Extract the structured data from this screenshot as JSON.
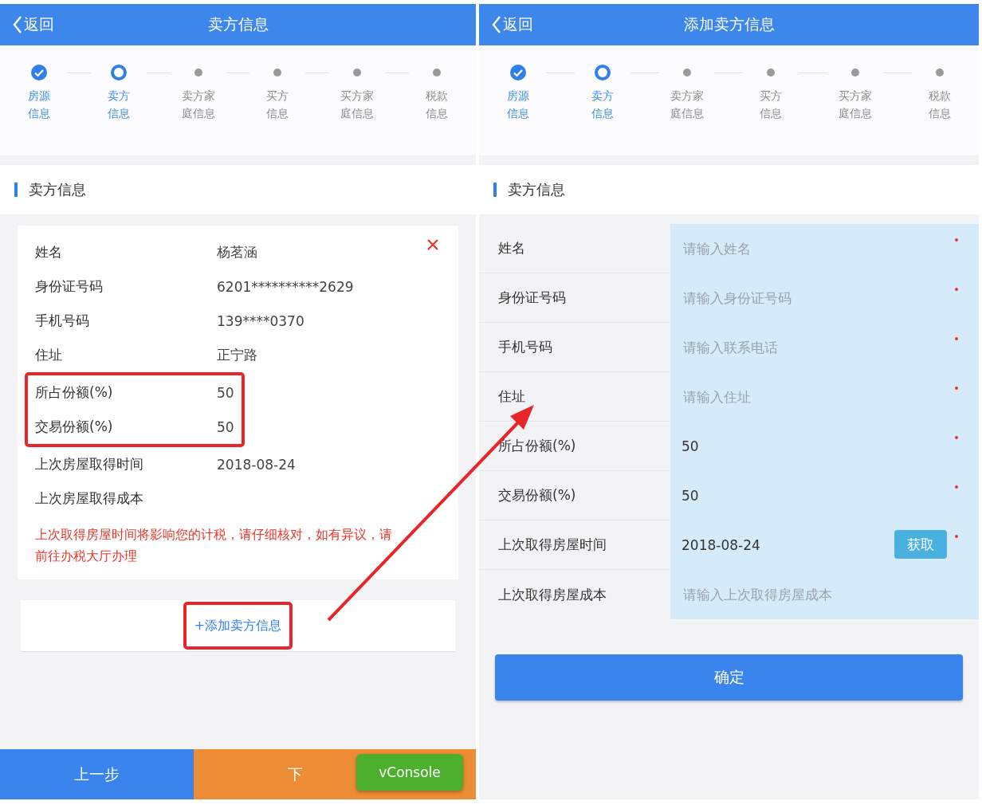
{
  "left": {
    "header": {
      "back": "返回",
      "title": "卖方信息"
    },
    "steps": [
      {
        "lines": [
          "房源",
          "信息"
        ],
        "done": true,
        "current": false
      },
      {
        "lines": [
          "卖方",
          "信息"
        ],
        "done": false,
        "current": true
      },
      {
        "lines": [
          "卖方家",
          "庭信息"
        ],
        "done": false,
        "current": false
      },
      {
        "lines": [
          "买方",
          "信息"
        ],
        "done": false,
        "current": false
      },
      {
        "lines": [
          "买方家",
          "庭信息"
        ],
        "done": false,
        "current": false
      },
      {
        "lines": [
          "税款",
          "信息"
        ],
        "done": false,
        "current": false
      }
    ],
    "section_title": "卖方信息",
    "seller_card": {
      "fields": [
        {
          "label": "姓名",
          "value": "杨茗涵",
          "highlighted": false
        },
        {
          "label": "身份证号码",
          "value": "6201**********2629",
          "highlighted": false
        },
        {
          "label": "手机号码",
          "value": "139****0370",
          "highlighted": false
        },
        {
          "label": "住址",
          "value": "正宁路",
          "highlighted": false
        },
        {
          "label": "所占份额(%)",
          "value": "50",
          "highlighted": true
        },
        {
          "label": "交易份额(%)",
          "value": "50",
          "highlighted": true
        },
        {
          "label": "上次房屋取得时间",
          "value": "2018-08-24",
          "highlighted": false
        },
        {
          "label": "上次房屋取得成本",
          "highlighted": false
        }
      ],
      "warning": "上次取得房屋时间将影响您的计税，请仔细核对，如有异议，请前往办税大厅办理"
    },
    "add_button": {
      "label": "+添加卖方信息",
      "highlighted": true
    },
    "bottom_nav": {
      "prev": "上一步",
      "next": "下"
    },
    "vconsole": "vConsole"
  },
  "right": {
    "header": {
      "back": "返回",
      "title": "添加卖方信息"
    },
    "steps": [
      {
        "lines": [
          "房源",
          "信息"
        ],
        "done": true,
        "current": false
      },
      {
        "lines": [
          "卖方",
          "信息"
        ],
        "done": false,
        "current": true
      },
      {
        "lines": [
          "卖方家",
          "庭信息"
        ],
        "done": false,
        "current": false
      },
      {
        "lines": [
          "买方",
          "信息"
        ],
        "done": false,
        "current": false
      },
      {
        "lines": [
          "买方家",
          "庭信息"
        ],
        "done": false,
        "current": false
      },
      {
        "lines": [
          "税款",
          "信息"
        ],
        "done": false,
        "current": false
      }
    ],
    "section_title": "卖方信息",
    "form": [
      {
        "label": "姓名",
        "placeholder": "请输入姓名",
        "required": true
      },
      {
        "label": "身份证号码",
        "placeholder": "请输入身份证号码",
        "required": true
      },
      {
        "label": "手机号码",
        "placeholder": "请输入联系电话",
        "required": true
      },
      {
        "label": "住址",
        "placeholder": "请输入住址",
        "required": true
      },
      {
        "label": "所占份额(%)",
        "value": "50",
        "required": true
      },
      {
        "label": "交易份额(%)",
        "value": "50",
        "required": true
      },
      {
        "label": "上次取得房屋时间",
        "value": "2018-08-24",
        "action": "获取",
        "required": true
      },
      {
        "label": "上次取得房屋成本",
        "placeholder": "请输入上次取得房屋成本",
        "required": false
      }
    ],
    "confirm": "确定"
  }
}
